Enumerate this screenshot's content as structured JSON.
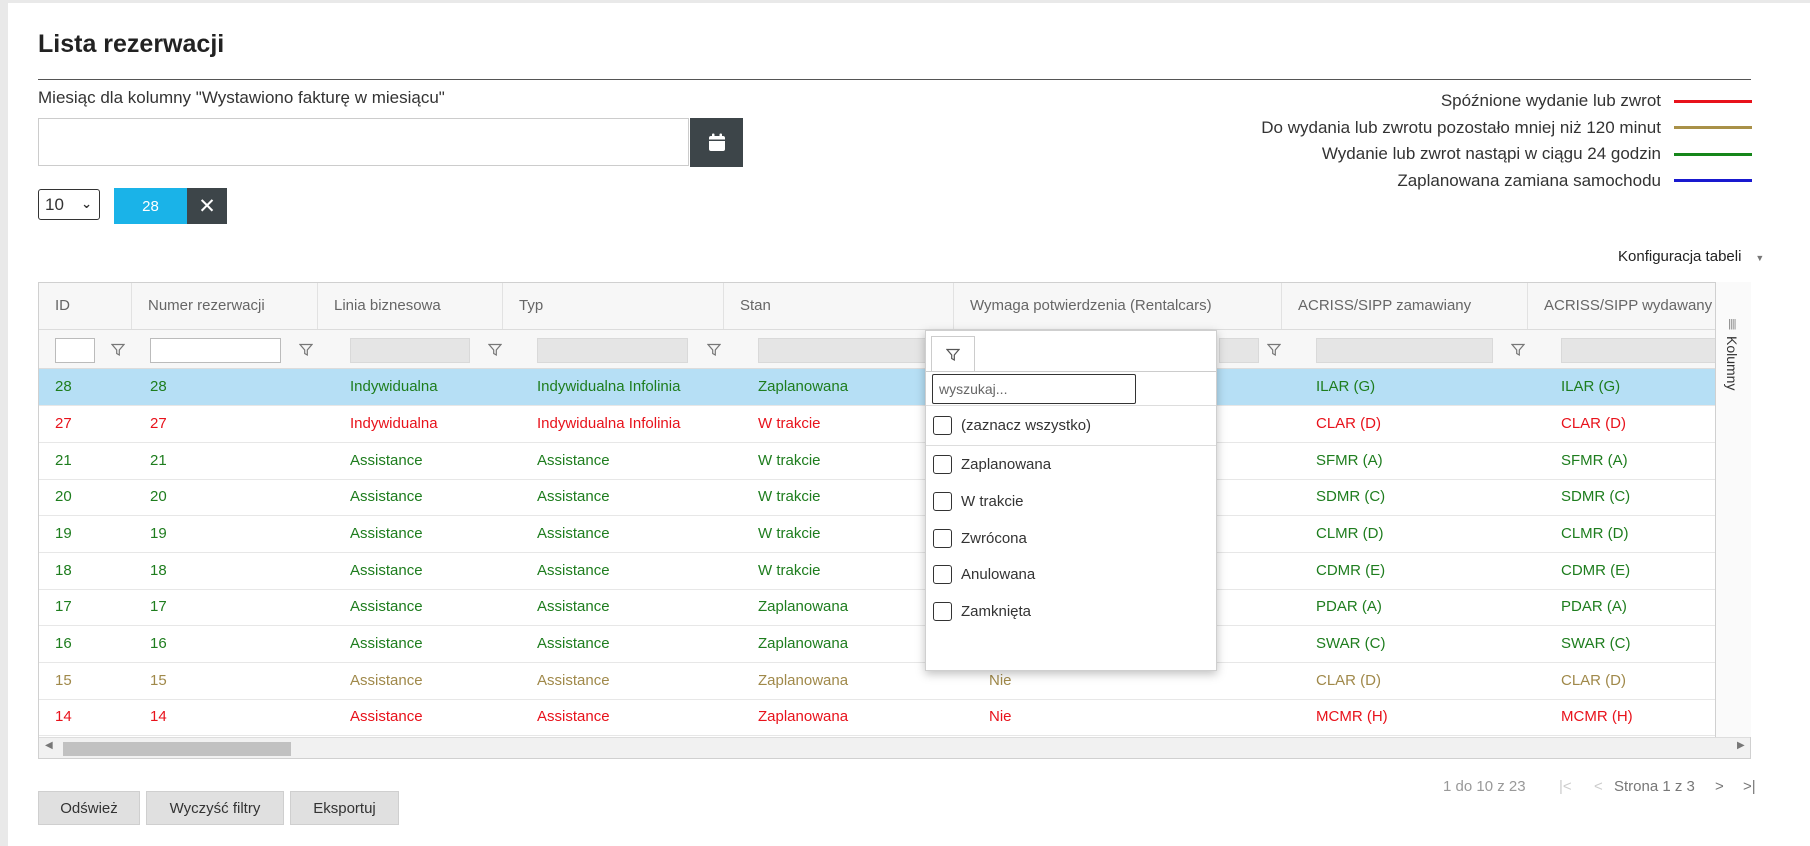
{
  "page": {
    "title": "Lista rezerwacji",
    "month_label": "Miesiąc dla kolumny \"Wystawiono fakturę w miesiącu\"",
    "month_value": ""
  },
  "legend": [
    {
      "label": "Spóźnione wydanie lub zwrot",
      "color": "#e8121b"
    },
    {
      "label": "Do wydania lub zwrotu pozostało mniej niż 120 minut",
      "color": "#a99148"
    },
    {
      "label": "Wydanie lub zwrot nastąpi w ciągu 24 godzin",
      "color": "#16861a"
    },
    {
      "label": "Zaplanowana zamiana samochodu",
      "color": "#1919cf"
    }
  ],
  "controls": {
    "page_size": "10",
    "filter_chip": "28",
    "table_config": "Konfiguracja tabeli"
  },
  "table": {
    "columns": [
      "ID",
      "Numer rezerwacji",
      "Linia biznesowa",
      "Typ",
      "Stan",
      "Wymaga potwierdzenia (Rentalcars)",
      "ACRISS/SIPP zamawiany",
      "ACRISS/SIPP wydawany"
    ],
    "side_panel_label": "Kolumny",
    "colors": {
      "red": "#e8121b",
      "green": "#1e7d1e",
      "olive": "#a0894a",
      "selected_text": "#1e7d1e",
      "selected_bg": "#b6dff5"
    },
    "rows": [
      {
        "color": "green",
        "selected": true,
        "cells": [
          "28",
          "28",
          "Indywidualna",
          "Indywidualna Infolinia",
          "Zaplanowana",
          "",
          "ILAR (G)",
          "ILAR (G)"
        ]
      },
      {
        "color": "red",
        "selected": false,
        "cells": [
          "27",
          "27",
          "Indywidualna",
          "Indywidualna Infolinia",
          "W trakcie",
          "",
          "CLAR (D)",
          "CLAR (D)"
        ]
      },
      {
        "color": "green",
        "selected": false,
        "cells": [
          "21",
          "21",
          "Assistance",
          "Assistance",
          "W trakcie",
          "",
          "SFMR (A)",
          "SFMR (A)"
        ]
      },
      {
        "color": "green",
        "selected": false,
        "cells": [
          "20",
          "20",
          "Assistance",
          "Assistance",
          "W trakcie",
          "",
          "SDMR (C)",
          "SDMR (C)"
        ]
      },
      {
        "color": "green",
        "selected": false,
        "cells": [
          "19",
          "19",
          "Assistance",
          "Assistance",
          "W trakcie",
          "",
          "CLMR (D)",
          "CLMR (D)"
        ]
      },
      {
        "color": "green",
        "selected": false,
        "cells": [
          "18",
          "18",
          "Assistance",
          "Assistance",
          "W trakcie",
          "",
          "CDMR (E)",
          "CDMR (E)"
        ]
      },
      {
        "color": "green",
        "selected": false,
        "cells": [
          "17",
          "17",
          "Assistance",
          "Assistance",
          "Zaplanowana",
          "",
          "PDAR (A)",
          "PDAR (A)"
        ]
      },
      {
        "color": "green",
        "selected": false,
        "cells": [
          "16",
          "16",
          "Assistance",
          "Assistance",
          "Zaplanowana",
          "",
          "SWAR (C)",
          "SWAR (C)"
        ]
      },
      {
        "color": "olive",
        "selected": false,
        "cells": [
          "15",
          "15",
          "Assistance",
          "Assistance",
          "Zaplanowana",
          "Nie",
          "CLAR (D)",
          "CLAR (D)"
        ]
      },
      {
        "color": "red",
        "selected": false,
        "cells": [
          "14",
          "14",
          "Assistance",
          "Assistance",
          "Zaplanowana",
          "Nie",
          "MCMR (H)",
          "MCMR (H)"
        ]
      }
    ]
  },
  "filter_dropdown": {
    "search_placeholder": "wyszukaj...",
    "select_all": "(zaznacz wszystko)",
    "options": [
      "Zaplanowana",
      "W trakcie",
      "Zwrócona",
      "Anulowana",
      "Zamknięta"
    ]
  },
  "pager": {
    "summary": "1 do 10 z 23",
    "page_text": "Strona 1 z 3",
    "first": "|<",
    "prev": "<",
    "next": ">",
    "last": ">|"
  },
  "buttons": {
    "refresh": "Odśwież",
    "clear_filters": "Wyczyść filtry",
    "export": "Eksportuj"
  }
}
